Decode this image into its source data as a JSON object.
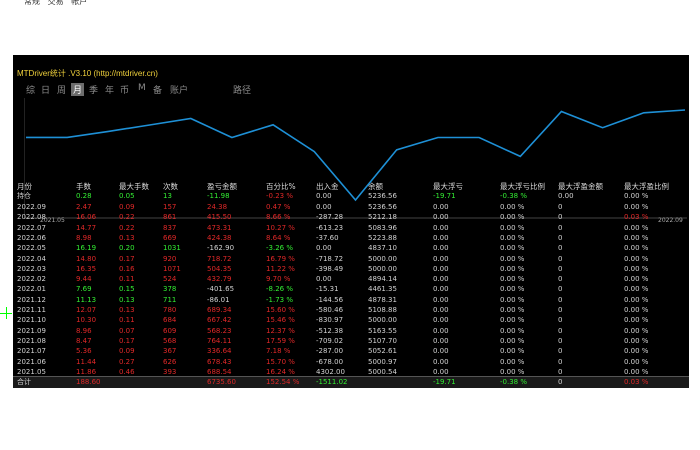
{
  "menu": [
    "常规",
    "交易",
    "帐户"
  ],
  "window": {
    "title": "MTDriver统计 .V3.10 (http://mtdriver.cn)",
    "tabs": [
      "综",
      "日",
      "周",
      "月",
      "季",
      "年",
      "币",
      "M",
      "备",
      "账户",
      "路径"
    ],
    "active_tab": "月"
  },
  "chart_data": {
    "type": "line",
    "x_start_label": "2021.05",
    "x_end_label": "2022.09",
    "x": [
      "2021.05",
      "2021.06",
      "2021.07",
      "2021.08",
      "2021.09",
      "2021.10",
      "2021.11",
      "2021.12",
      "2022.01",
      "2022.02",
      "2022.03",
      "2022.04",
      "2022.05",
      "2022.06",
      "2022.07",
      "2022.08",
      "2022.09"
    ],
    "values": [
      5000.54,
      5000.97,
      5052.61,
      5107.7,
      5163.55,
      5000.0,
      5108.88,
      4878.31,
      4461.35,
      4894.14,
      5000.0,
      5000.0,
      4837.1,
      5223.88,
      5083.96,
      5212.18,
      5236.56
    ],
    "color": "#1e90d6",
    "grid": false,
    "legend": "none"
  },
  "table": {
    "headers": [
      "月份",
      "手数",
      "最大手数",
      "次数",
      "盈亏金额",
      "百分比%",
      "出入金",
      "余额",
      "最大浮亏",
      "最大浮亏比例",
      "最大浮盈金额",
      "最大浮盈比例"
    ],
    "holding": [
      "持仓",
      "0.28",
      "0.05",
      "13",
      "-11.98",
      "-0.23 %",
      "0.00",
      "5236.56",
      "-19.71",
      "-0.38 %",
      "0.00",
      "0.00 %"
    ],
    "rows": [
      [
        "2022.09",
        "2.47",
        "0.09",
        "157",
        "24.38",
        "0.47 %",
        "0.00",
        "5236.56",
        "0.00",
        "0.00 %",
        "0",
        "0.00 %"
      ],
      [
        "2022.08",
        "16.06",
        "0.22",
        "861",
        "415.50",
        "8.66 %",
        "-287.28",
        "5212.18",
        "0.00",
        "0.00 %",
        "0",
        "0.03 %"
      ],
      [
        "2022.07",
        "14.77",
        "0.22",
        "837",
        "473.31",
        "10.27 %",
        "-613.23",
        "5083.96",
        "0.00",
        "0.00 %",
        "0",
        "0.00 %"
      ],
      [
        "2022.06",
        "8.98",
        "0.13",
        "669",
        "424.38",
        "8.64 %",
        "-37.60",
        "5223.88",
        "0.00",
        "0.00 %",
        "0",
        "0.00 %"
      ],
      [
        "2022.05",
        "16.19",
        "0.20",
        "1031",
        "-162.90",
        "-3.26 %",
        "0.00",
        "4837.10",
        "0.00",
        "0.00 %",
        "0",
        "0.00 %"
      ],
      [
        "2022.04",
        "14.80",
        "0.17",
        "920",
        "718.72",
        "16.79 %",
        "-718.72",
        "5000.00",
        "0.00",
        "0.00 %",
        "0",
        "0.00 %"
      ],
      [
        "2022.03",
        "16.35",
        "0.16",
        "1071",
        "504.35",
        "11.22 %",
        "-398.49",
        "5000.00",
        "0.00",
        "0.00 %",
        "0",
        "0.00 %"
      ],
      [
        "2022.02",
        "9.44",
        "0.11",
        "524",
        "432.79",
        "9.70 %",
        "0.00",
        "4894.14",
        "0.00",
        "0.00 %",
        "0",
        "0.00 %"
      ],
      [
        "2022.01",
        "7.69",
        "0.15",
        "378",
        "-401.65",
        "-8.26 %",
        "-15.31",
        "4461.35",
        "0.00",
        "0.00 %",
        "0",
        "0.00 %"
      ],
      [
        "2021.12",
        "11.13",
        "0.13",
        "711",
        "-86.01",
        "-1.73 %",
        "-144.56",
        "4878.31",
        "0.00",
        "0.00 %",
        "0",
        "0.00 %"
      ],
      [
        "2021.11",
        "12.07",
        "0.13",
        "780",
        "689.34",
        "15.60 %",
        "-580.46",
        "5108.88",
        "0.00",
        "0.00 %",
        "0",
        "0.00 %"
      ],
      [
        "2021.10",
        "10.30",
        "0.11",
        "684",
        "667.42",
        "15.46 %",
        "-830.97",
        "5000.00",
        "0.00",
        "0.00 %",
        "0",
        "0.00 %"
      ],
      [
        "2021.09",
        "8.96",
        "0.07",
        "609",
        "568.23",
        "12.37 %",
        "-512.38",
        "5163.55",
        "0.00",
        "0.00 %",
        "0",
        "0.00 %"
      ],
      [
        "2021.08",
        "8.47",
        "0.17",
        "568",
        "764.11",
        "17.59 %",
        "-709.02",
        "5107.70",
        "0.00",
        "0.00 %",
        "0",
        "0.00 %"
      ],
      [
        "2021.07",
        "5.36",
        "0.09",
        "367",
        "336.64",
        "7.18 %",
        "-287.00",
        "5052.61",
        "0.00",
        "0.00 %",
        "0",
        "0.00 %"
      ],
      [
        "2021.06",
        "11.44",
        "0.27",
        "626",
        "678.43",
        "15.70 %",
        "-678.00",
        "5000.97",
        "0.00",
        "0.00 %",
        "0",
        "0.00 %"
      ],
      [
        "2021.05",
        "11.86",
        "0.46",
        "393",
        "688.54",
        "16.24 %",
        "4302.00",
        "5000.54",
        "0.00",
        "0.00 %",
        "0",
        "0.00 %"
      ]
    ],
    "total": [
      "合计",
      "188.60",
      "",
      "",
      "6735.60",
      "152.54 %",
      "-1511.02",
      "",
      "-19.71",
      "-0.38 %",
      "0",
      "0.03 %"
    ]
  },
  "colors": {
    "positive": "#33ee33",
    "negative": "#e02828",
    "neutral": "#d2d2d2",
    "title": "#f1d23c",
    "curve": "#1e90d6"
  }
}
